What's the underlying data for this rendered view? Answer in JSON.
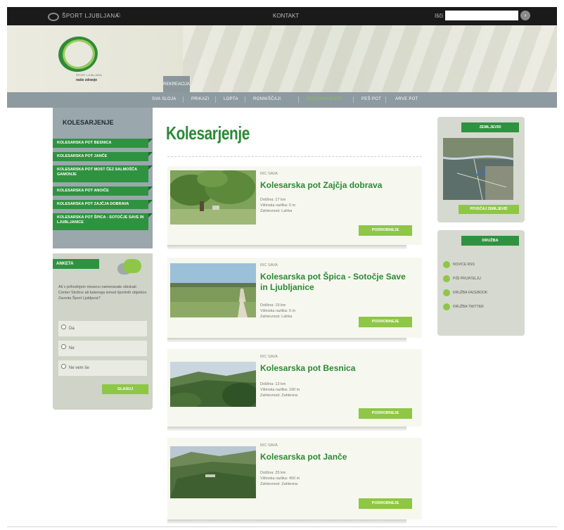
{
  "topbar": {
    "brand": "ŠPORT LJUBLJANA",
    "contact": "KONTAKT",
    "search_label": "Išči",
    "search_value": ""
  },
  "logo": {
    "line1": "ŠPORT LJUBLJANA",
    "line2": "naše zdravje"
  },
  "header_tab": "REKREACIJA",
  "nav": {
    "items": [
      "SVA SLOJA",
      "PRIKAZI",
      "LOPTA",
      "RONNIŠČAJI",
      "KOLESARJENJE",
      "PEŠ POT",
      "ARVE POT"
    ],
    "active": "KOLESARJENJE",
    "active_color": "#8ec646"
  },
  "left": {
    "title": "KOLESARJENJE",
    "items": [
      "KOLESARSKA POT BESNICA",
      "KOLESARSKA POT JANČE",
      "KOLESARSKA POT MOST ČEZ SALMOŠČA GAMONJE",
      "KOLESARSKA POT ANOIČE",
      "KOLESARSKA POT ZAJČJA DOBRAVA",
      "KOLESARSKA POT ŠPICA - SOTOČJE SAVE IN LJUBLJANICE"
    ]
  },
  "poll": {
    "tag": "ANKETA",
    "question": "Ali v prihodnjem mesecu nameravate obiskati Center Stožice ali katerega izmed športnih objektov Zavoda Šport Ljubljana?",
    "options": [
      "Da",
      "Ne",
      "Ne vem še"
    ],
    "button": "GLASUJ"
  },
  "main": {
    "title": "Kolesarjenje",
    "cards": [
      {
        "category": "RIC SAVA",
        "title": "Kolesarska pot Zajčja dobrava",
        "meta": [
          "Dolžina: 17 km",
          "Višinska razlika: 0 m",
          "Zahtevnost: Lahka"
        ],
        "button": "PODROBNEJE"
      },
      {
        "category": "RIC SAVA",
        "title": "Kolesarska pot Špica - Sotočje Save in Ljubljanice",
        "meta": [
          "Dolžina: 19 km",
          "Višinska razlika: 0 m",
          "Zahtevnost: Lahka"
        ],
        "button": "PODROBNEJE"
      },
      {
        "category": "RIC SAVA",
        "title": "Kolesarska pot Besnica",
        "meta": [
          "Dolžina: 13 km",
          "Višinska razlika: 190 m",
          "Zahtevnost: Zahtevna"
        ],
        "button": "PODROBNEJE"
      },
      {
        "category": "RIC SAVA",
        "title": "Kolesarska pot Janče",
        "meta": [
          "Dolžina: 25 km",
          "Višinska razlika: 450 m",
          "Zahtevnost: Zahtevna"
        ],
        "button": "PODROBNEJE"
      }
    ]
  },
  "right": {
    "map_tag": "ZEMLJEVID",
    "map_button": "POVEČAJ ZEMLJEVID",
    "social_tag": "DRUŽBA",
    "social_links": [
      "NOVICE RSS",
      "PIŠI PRIJATELJU",
      "DRUŽBA FACEBOOK",
      "DRUŽBA TWITTER"
    ]
  }
}
